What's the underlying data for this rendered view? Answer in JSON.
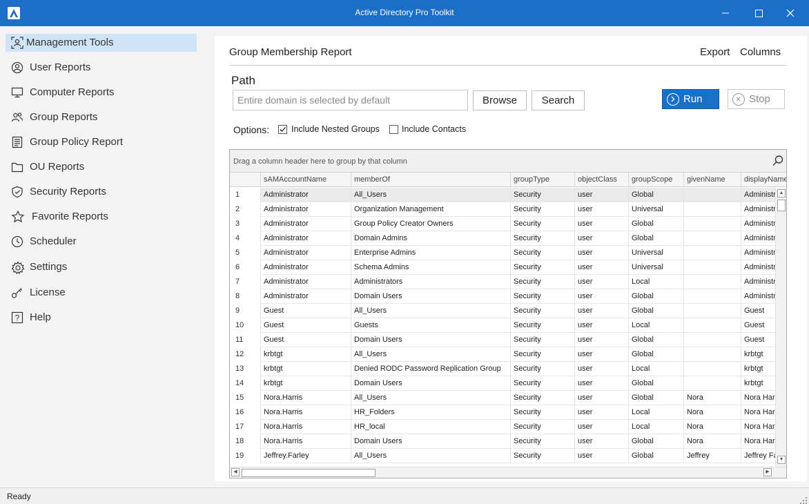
{
  "app": {
    "title": "Active Directory Pro Toolkit"
  },
  "window": {
    "minimize_glyph": "—",
    "maximize_glyph": "☐",
    "close_glyph": "✕"
  },
  "sidebar": {
    "items": [
      {
        "label": "Management Tools",
        "icon": "management-tools-icon",
        "active": true
      },
      {
        "label": "User Reports",
        "icon": "user-icon"
      },
      {
        "label": "Computer Reports",
        "icon": "computer-icon"
      },
      {
        "label": "Group Reports",
        "icon": "group-icon"
      },
      {
        "label": "Group Policy Report",
        "icon": "policy-icon"
      },
      {
        "label": "OU Reports",
        "icon": "folder-icon"
      },
      {
        "label": "Security Reports",
        "icon": "shield-icon"
      },
      {
        "label": "Favorite Reports",
        "icon": "star-icon"
      },
      {
        "label": "Scheduler",
        "icon": "clock-icon"
      },
      {
        "label": "Settings",
        "icon": "gear-icon"
      },
      {
        "label": "License",
        "icon": "key-icon"
      },
      {
        "label": "Help",
        "icon": "help-icon"
      }
    ]
  },
  "report": {
    "title": "Group Membership Report",
    "export_label": "Export",
    "columns_label": "Columns",
    "path_label": "Path",
    "path_placeholder": "Entire domain is selected by default",
    "browse_label": "Browse",
    "search_label": "Search",
    "run_label": "Run",
    "stop_label": "Stop",
    "options_label": "Options:",
    "options": [
      {
        "label": "Include Nested Groups",
        "checked": true
      },
      {
        "label": "Include Contacts",
        "checked": false
      }
    ]
  },
  "grid": {
    "group_hint": "Drag a column header here to group by that column",
    "columns": [
      "sAMAccountName",
      "memberOf",
      "groupType",
      "objectClass",
      "groupScope",
      "givenName",
      "displayName"
    ],
    "rows": [
      [
        "1",
        "Administrator",
        "All_Users",
        "Security",
        "user",
        "Global",
        "",
        "Administrator"
      ],
      [
        "2",
        "Administrator",
        "Organization Management",
        "Security",
        "user",
        "Universal",
        "",
        "Administrator"
      ],
      [
        "3",
        "Administrator",
        "Group Policy Creator Owners",
        "Security",
        "user",
        "Global",
        "",
        "Administrator"
      ],
      [
        "4",
        "Administrator",
        "Domain Admins",
        "Security",
        "user",
        "Global",
        "",
        "Administrator"
      ],
      [
        "5",
        "Administrator",
        "Enterprise Admins",
        "Security",
        "user",
        "Universal",
        "",
        "Administrator"
      ],
      [
        "6",
        "Administrator",
        "Schema Admins",
        "Security",
        "user",
        "Universal",
        "",
        "Administrator"
      ],
      [
        "7",
        "Administrator",
        "Administrators",
        "Security",
        "user",
        "Local",
        "",
        "Administrator"
      ],
      [
        "8",
        "Administrator",
        "Domain Users",
        "Security",
        "user",
        "Global",
        "",
        "Administrator"
      ],
      [
        "9",
        "Guest",
        "All_Users",
        "Security",
        "user",
        "Global",
        "",
        "Guest"
      ],
      [
        "10",
        "Guest",
        "Guests",
        "Security",
        "user",
        "Local",
        "",
        "Guest"
      ],
      [
        "11",
        "Guest",
        "Domain Users",
        "Security",
        "user",
        "Global",
        "",
        "Guest"
      ],
      [
        "12",
        "krbtgt",
        "All_Users",
        "Security",
        "user",
        "Global",
        "",
        "krbtgt"
      ],
      [
        "13",
        "krbtgt",
        "Denied RODC Password Replication Group",
        "Security",
        "user",
        "Local",
        "",
        "krbtgt"
      ],
      [
        "14",
        "krbtgt",
        "Domain Users",
        "Security",
        "user",
        "Global",
        "",
        "krbtgt"
      ],
      [
        "15",
        "Nora.Harris",
        "All_Users",
        "Security",
        "user",
        "Global",
        "Nora",
        "Nora Harris"
      ],
      [
        "16",
        "Nora.Harris",
        "HR_Folders",
        "Security",
        "user",
        "Local",
        "Nora",
        "Nora Harris"
      ],
      [
        "17",
        "Nora.Harris",
        "HR_local",
        "Security",
        "user",
        "Local",
        "Nora",
        "Nora Harris"
      ],
      [
        "18",
        "Nora.Harris",
        "Domain Users",
        "Security",
        "user",
        "Global",
        "Nora",
        "Nora Harris"
      ],
      [
        "19",
        "Jeffrey.Farley",
        "All_Users",
        "Security",
        "user",
        "Global",
        "Jeffrey",
        "Jeffrey Farley"
      ]
    ]
  },
  "status": {
    "text": "Ready"
  },
  "colors": {
    "accent": "#1c6fc6",
    "sidebar_active": "#d0e4f7",
    "sidebar_bg": "#f3f3f3"
  }
}
